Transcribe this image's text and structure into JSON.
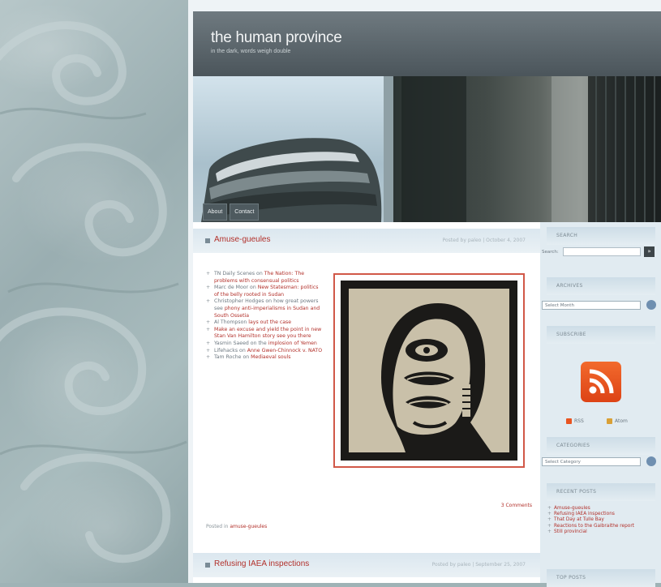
{
  "site": {
    "title": "the human province",
    "tagline": "in the dark, words weigh double"
  },
  "nav": [
    {
      "label": "About"
    },
    {
      "label": "Contact"
    }
  ],
  "post1": {
    "title": "Amuse-gueules",
    "meta": "Posted by paleo | October 4, 2007",
    "links": [
      {
        "text": "TN Daily Scenes on ",
        "link": "The Nation: The problems with consensual politics"
      },
      {
        "text": "Marc de Moor on ",
        "link": "New Statesman: politics of the belly rooted in Sudan"
      },
      {
        "text": "Christopher Hodges on how great powers see ",
        "link": "phony anti-imperialisms in Sudan and South Ossetia"
      },
      {
        "text": "Al Thompson ",
        "link": "lays out the case"
      },
      {
        "text": "",
        "link": "Make an excuse and yield the point in new Stan Van Hamilton story see you there"
      },
      {
        "text": "Yasmin Saeed on the ",
        "link": "implosion of Yemen"
      },
      {
        "text": "Lifehacks on ",
        "link": "Anne Gwen-Chinnock v. NATO"
      },
      {
        "text": "Tam Roche on ",
        "link": "Mediaeval souls"
      }
    ],
    "comments": "3 Comments",
    "posted_in_label": "Posted in ",
    "posted_in_link": "amuse-gueules"
  },
  "post2": {
    "title": "Refusing IAEA inspections",
    "meta": "Posted by paleo | September 25, 2007"
  },
  "sidebar": {
    "search": {
      "title": "SEARCH",
      "label": "Search:",
      "button": "»"
    },
    "archives": {
      "title": "ARCHIVES",
      "select": "Select Month"
    },
    "subscribe": {
      "title": "SUBSCRIBE",
      "feed1": "RSS",
      "feed2": "Atom"
    },
    "categories": {
      "title": "CATEGORIES",
      "select": "Select Category"
    },
    "recent": {
      "title": "RECENT POSTS",
      "items": [
        "Amuse-gueules",
        "Refusing IAEA inspections",
        "That Day at Tulle Bay",
        "Reactions to the Galbraithe report",
        "Still provincial"
      ]
    },
    "top_posts": {
      "title": "TOP POSTS"
    }
  },
  "colors": {
    "accent": "#b2302a",
    "header": "#4b555b",
    "rss": "#e95420"
  }
}
